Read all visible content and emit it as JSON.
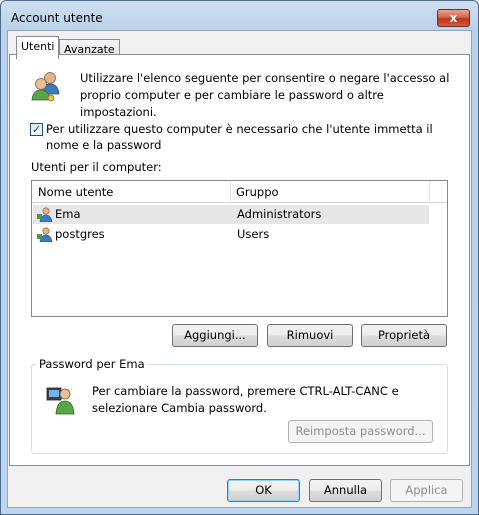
{
  "window": {
    "title": "Account utente",
    "close_glyph": "x"
  },
  "tabs": [
    {
      "label": "Utenti",
      "active": true
    },
    {
      "label": "Avanzate",
      "active": false
    }
  ],
  "intro": {
    "icon": "users-icon",
    "text": "Utilizzare l'elenco seguente per consentire o negare l'accesso al proprio computer e per cambiare le password o altre impostazioni."
  },
  "require_login": {
    "checked": true,
    "check_glyph": "✓",
    "label": "Per utilizzare questo computer è necessario che l'utente immetta il nome e la password"
  },
  "users_list": {
    "label": "Utenti per il computer:",
    "columns": [
      "Nome utente",
      "Gruppo"
    ],
    "rows": [
      {
        "name": "Ema",
        "group": "Administrators",
        "selected": true,
        "icon": "user-icon"
      },
      {
        "name": "postgres",
        "group": "Users",
        "selected": false,
        "icon": "user-icon"
      }
    ]
  },
  "list_buttons": {
    "add": "Aggiungi...",
    "remove": "Rimuovi",
    "properties": "Proprietà"
  },
  "password_group": {
    "title": "Password per Ema",
    "icon": "user-key-icon",
    "text": "Per cambiare la password, premere CTRL-ALT-CANC e selezionare Cambia password.",
    "reset_button": "Reimposta password..."
  },
  "footer": {
    "ok": "OK",
    "cancel": "Annulla",
    "apply": "Applica"
  }
}
